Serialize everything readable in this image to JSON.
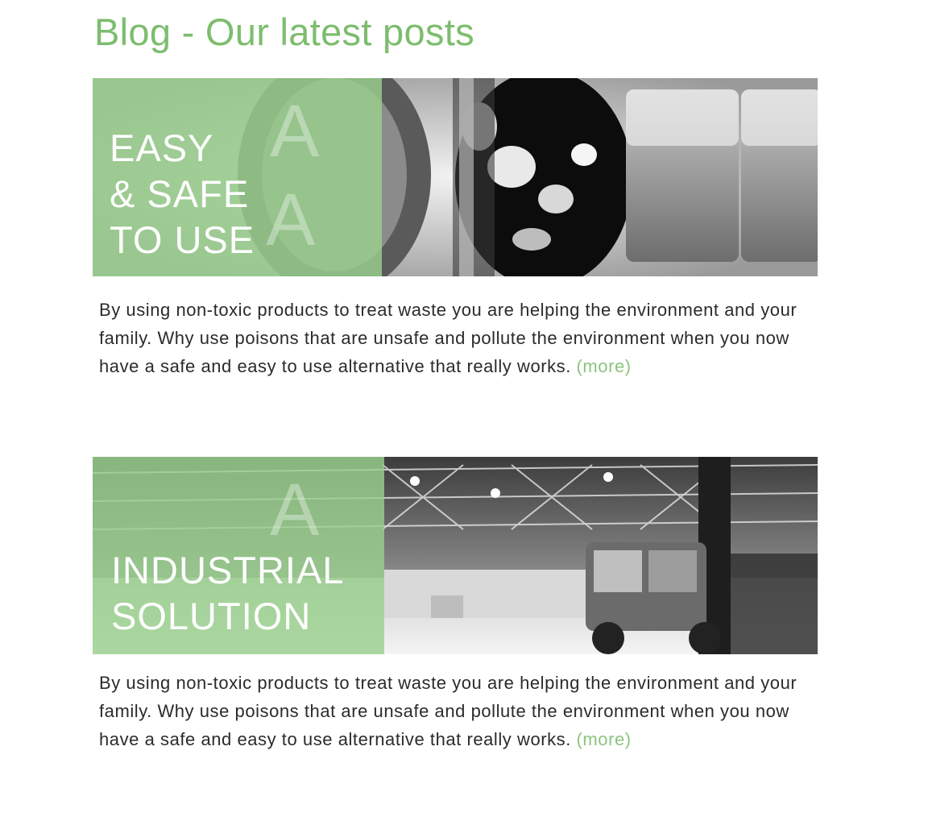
{
  "page": {
    "title": "Blog - Our latest posts"
  },
  "colors": {
    "accent": "#7cbd6e",
    "overlay": "#99d18c",
    "link": "#8cc47f",
    "body_text": "#2b2b2b"
  },
  "posts": [
    {
      "banner_lines": [
        "EASY",
        "& SAFE",
        "TO USE"
      ],
      "excerpt": "By using non-toxic products to treat waste you are helping the environment and your family. Why use poisons that are unsafe and pollute the environment when you now have a safe and easy to use alternative that really works.",
      "more_label": "(more)"
    },
    {
      "banner_lines": [
        "INDUSTRIAL",
        "SOLUTION"
      ],
      "excerpt": "By using non-toxic products to treat waste you are helping the environment and your family. Why use poisons that are unsafe and pollute the environment when you now have a safe and easy to use alternative that really works.",
      "more_label": "(more)"
    }
  ]
}
